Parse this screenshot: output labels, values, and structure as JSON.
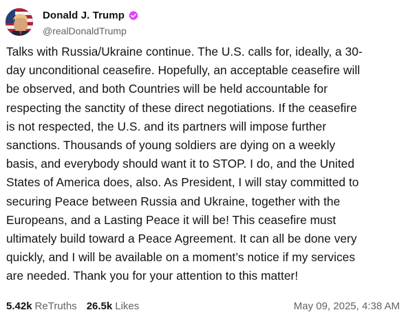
{
  "post": {
    "author": {
      "display_name": "Donald J. Trump",
      "handle": "@realDonaldTrump",
      "verified": true,
      "verified_color": "#e040fb"
    },
    "text": "Talks with Russia/Ukraine continue. The U.S. calls for, ideally, a 30-\nday unconditional ceasefire. Hopefully, an acceptable ceasefire will\nbe observed, and both Countries will be held accountable for\nrespecting the sanctity of these direct negotiations. If the ceasefire\nis not respected, the U.S. and its partners will impose further\nsanctions. Thousands of young soldiers are dying on a weekly\nbasis, and everybody should want it to STOP. I do, and the United\nStates of America does, also. As President, I will stay committed to\nsecuring Peace between Russia and Ukraine, together with the\nEuropeans, and a Lasting Peace it will be! This ceasefire must\nultimately build toward a Peace Agreement. It can all be done very\nquickly, and I will be available on a moment’s notice if my services\nare needed. Thank you for your attention to this matter!",
    "stats": {
      "retruths_count": "5.42k",
      "retruths_label": "ReTruths",
      "likes_count": "26.5k",
      "likes_label": "Likes"
    },
    "timestamp": "May 09, 2025, 4:38 AM"
  },
  "icons": {
    "avatar": "avatar-image",
    "verified": "verified-badge-icon"
  }
}
